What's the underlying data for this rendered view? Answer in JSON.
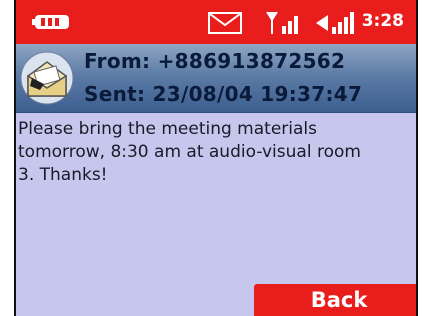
{
  "status_bar": {
    "time": "3:28",
    "icons": [
      "battery-icon",
      "mail-icon",
      "signal-icon",
      "signal-strength-icon"
    ]
  },
  "message": {
    "from": "From: +886913872562",
    "sent": "Sent: 23/08/04 19:37:47",
    "body": "Please bring the meeting materials tomorrow, 8:30 am at audio-visual room 3. Thanks!"
  },
  "softkeys": {
    "right_label": "Back"
  },
  "colors": {
    "status_bar": "#ea1d1d",
    "background": "#c7c6ec",
    "header": "#4a6a9a",
    "softkey": "#ea1d1d"
  }
}
